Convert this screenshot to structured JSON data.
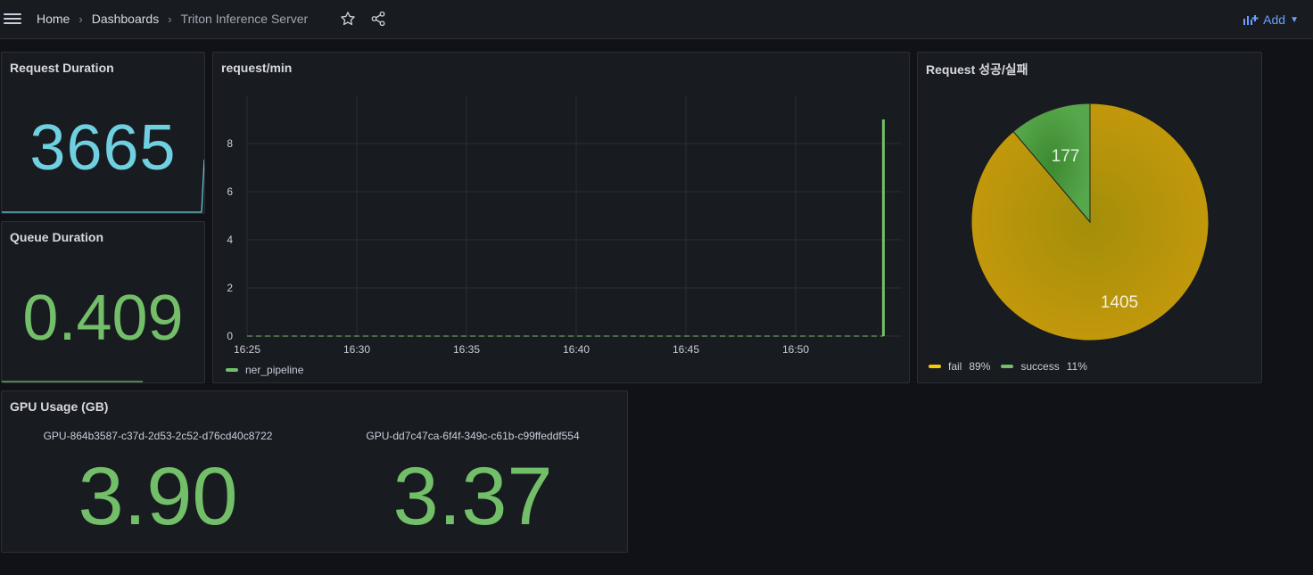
{
  "topbar": {
    "breadcrumbs": [
      "Home",
      "Dashboards"
    ],
    "current": "Triton Inference Server",
    "add_label": "Add"
  },
  "panels": {
    "request_duration": {
      "title": "Request Duration",
      "value": "3665",
      "color": "#6ed0e0"
    },
    "queue_duration": {
      "title": "Queue Duration",
      "value": "0.409",
      "color": "#73bf69"
    },
    "request_min": {
      "title": "request/min",
      "legend": "ner_pipeline",
      "color": "#73bf69"
    },
    "request_pie": {
      "title": "Request 성공/실패",
      "legend": [
        {
          "name": "fail",
          "pct": "89%",
          "color": "#f2cc0c"
        },
        {
          "name": "success",
          "pct": "11%",
          "color": "#73bf69"
        }
      ]
    },
    "gpu_usage": {
      "title": "GPU Usage (GB)",
      "gpus": [
        {
          "name": "GPU-864b3587-c37d-2d53-2c52-d76cd40c8722",
          "value": "3.90"
        },
        {
          "name": "GPU-dd7c47ca-6f4f-349c-c61b-c99ffeddf554",
          "value": "3.37"
        }
      ]
    }
  },
  "chart_data": [
    {
      "type": "line",
      "title": "request/min",
      "x_ticks": [
        "16:25",
        "16:30",
        "16:35",
        "16:40",
        "16:45",
        "16:50"
      ],
      "y_ticks": [
        "0",
        "2",
        "4",
        "6",
        "8"
      ],
      "ylim": [
        0,
        10
      ],
      "series": [
        {
          "name": "ner_pipeline",
          "x": [
            "16:25",
            "16:50",
            "16:54",
            "16:54"
          ],
          "y": [
            0,
            0,
            0,
            9
          ]
        }
      ],
      "grid": true,
      "legend": "bottom-left"
    },
    {
      "type": "pie",
      "title": "Request 성공/실패",
      "labels": [
        "fail",
        "success"
      ],
      "values": [
        1405,
        177
      ],
      "legend": "bottom-left"
    }
  ]
}
